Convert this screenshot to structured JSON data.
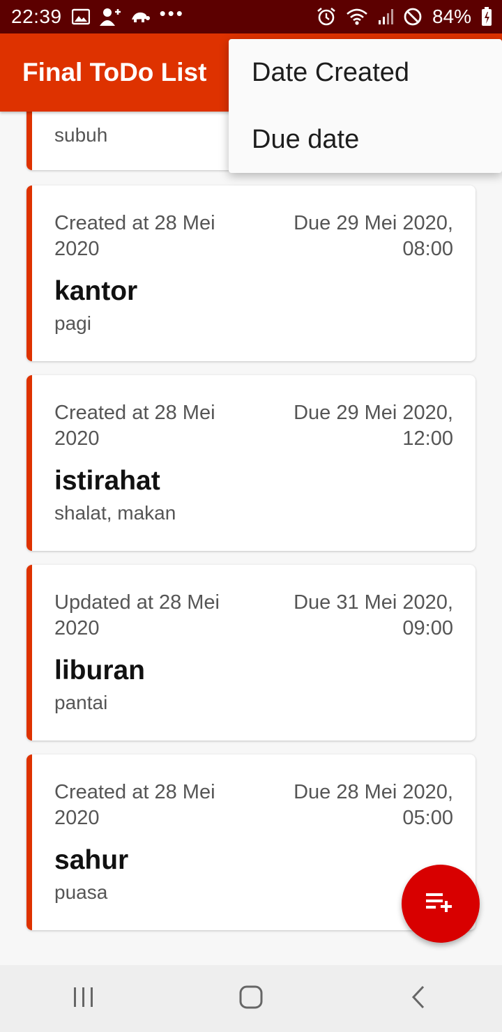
{
  "status_bar": {
    "time": "22:39",
    "battery": "84%",
    "icons_left": [
      "gallery-icon",
      "add-contact-icon",
      "turtle-icon",
      "more-notifications-icon"
    ],
    "icons_right": [
      "alarm-icon",
      "wifi-icon",
      "signal-icon",
      "do-not-disturb-icon",
      "battery-icon"
    ]
  },
  "app_bar": {
    "title": "Final ToDo List"
  },
  "menu": {
    "items": [
      {
        "label": "Date Created"
      },
      {
        "label": "Due date"
      }
    ]
  },
  "partial_card": {
    "description": "subuh"
  },
  "cards": [
    {
      "created": "Created at 28 Mei 2020",
      "due": "Due 29 Mei 2020, 08:00",
      "title": "kantor",
      "description": "pagi"
    },
    {
      "created": "Created at 28 Mei 2020",
      "due": "Due 29 Mei 2020, 12:00",
      "title": "istirahat",
      "description": "shalat, makan"
    },
    {
      "created": "Updated at 28 Mei 2020",
      "due": "Due 31 Mei 2020, 09:00",
      "title": "liburan",
      "description": "pantai"
    },
    {
      "created": "Created at 28 Mei 2020",
      "due": "Due 28 Mei 2020, 05:00",
      "title": "sahur",
      "description": "puasa"
    }
  ],
  "fab": {
    "icon": "playlist-add-icon"
  },
  "nav": {
    "icons": [
      "recent-apps-icon",
      "home-icon",
      "back-icon"
    ]
  },
  "colors": {
    "accent": "#de3200",
    "status_bar": "#5c0000",
    "fab": "#d80000"
  }
}
